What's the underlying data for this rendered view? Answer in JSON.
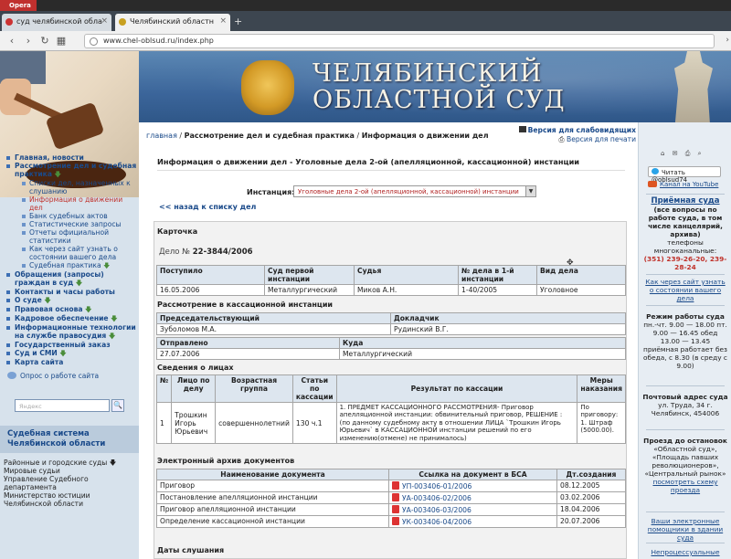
{
  "browser": {
    "opera_label": "Opera",
    "tabs": [
      {
        "title": "суд челябинской обла"
      },
      {
        "title": "Челябинский областн"
      }
    ],
    "url": "www.chel-oblsud.ru/index.php"
  },
  "banner": {
    "title_line1": "ЧЕЛЯБИНСКИЙ",
    "title_line2": "ОБЛАСТНОЙ СУД"
  },
  "breadcrumb": {
    "home": "главная",
    "sep": " / ",
    "level2": "Рассмотрение дел и судебная практика",
    "level3": "Информация о движении дел"
  },
  "versions": {
    "visually_impaired": "Версия для слабовидящих",
    "print": "Версия для печати"
  },
  "sidebar": {
    "menu": [
      {
        "label": "Главная, новости",
        "type": "item"
      },
      {
        "label": "Рассмотрение дел и судебная практика",
        "type": "item",
        "arrow": "🡇"
      },
      {
        "label": "Списки дел, назначенных к слушанию",
        "type": "sub"
      },
      {
        "label": "Информация о движении дел",
        "type": "sub",
        "current": true
      },
      {
        "label": "Банк судебных актов",
        "type": "sub"
      },
      {
        "label": "Статистические запросы",
        "type": "sub"
      },
      {
        "label": "Отчеты официальной статистики",
        "type": "sub"
      },
      {
        "label": "Как через сайт узнать о состоянии вашего дела",
        "type": "sub"
      },
      {
        "label": "Судебная практика",
        "type": "sub",
        "arrow": "🡇"
      },
      {
        "label": "Обращения (запросы) граждан в суд",
        "type": "item",
        "arrow": "🡇"
      },
      {
        "label": "Контакты и часы работы",
        "type": "item"
      },
      {
        "label": "О суде",
        "type": "item",
        "arrow": "🡇"
      },
      {
        "label": "Правовая основа",
        "type": "item",
        "arrow": "🡇"
      },
      {
        "label": "Кадровое обеспечение",
        "type": "item",
        "arrow": "🡇"
      },
      {
        "label": "Информационные технологии на службе правосудия",
        "type": "item",
        "arrow": "🡇"
      },
      {
        "label": "Государственный заказ",
        "type": "item"
      },
      {
        "label": "Суд и СМИ",
        "type": "item",
        "arrow": "🡇"
      },
      {
        "label": "Карта сайта",
        "type": "item"
      }
    ],
    "ask_link": "Опрос о работе сайта",
    "search_placeholder": "Яндекс",
    "search_button": "🔍",
    "system_title": "Судебная система Челябинской области",
    "system_menu": [
      {
        "label": "Районные и городские суды",
        "arrow": "🡇"
      },
      {
        "label": "Мировые судьи"
      },
      {
        "label": "Управление Судебного департамента"
      },
      {
        "label": "Министерство юстиции Челябинской области"
      }
    ]
  },
  "main": {
    "heading": "Информация о движении дел - Уголовные дела 2-ой (апелляционной, кассационной) инстанции",
    "instance_label": "Инстанция:",
    "instance_value": "Уголовные дела 2-ой (апелляционной, кассационной) инстанции",
    "back_link": "<< назад к списку дел",
    "card_title": "Карточка",
    "case_prefix": "Дело № ",
    "case_number": "22-3844/2006",
    "case_table": {
      "headers": [
        "Поступило",
        "Суд первой инстанции",
        "Судья",
        "№ дела в 1-й инстанции",
        "Вид дела"
      ],
      "row": [
        "16.05.2006",
        "Металлургический",
        "Миков А.Н.",
        "1-40/2005",
        "Уголовное"
      ]
    },
    "cassation_title": "Рассмотрение в кассационной инстанции",
    "cassation_table": {
      "h1": "Председательствующий",
      "h2": "Докладчик",
      "v1": "Зуболомов М.А.",
      "v2": "Рудинский В.Г.",
      "h3": "Отправлено",
      "h4": "Куда",
      "v3": "27.07.2006",
      "v4": "Металлургический"
    },
    "persons_title": "Сведения о лицах",
    "persons_table": {
      "headers": [
        "№",
        "Лицо по делу",
        "Возрастная группа",
        "Статьи по кассации",
        "Результат по кассации",
        "Меры наказания"
      ],
      "row": {
        "n": "1",
        "person": "Трошкин Игорь Юрьевич",
        "age": "совершеннолетний",
        "article": "130 ч.1",
        "result": "1. ПРЕДМЕТ КАССАЦИОННОГО РАССМОТРЕНИЯ- Приговор апелляционной инстанции: обвинительный приговор, РЕШЕНИЕ : (по данному судебному акту в отношении ЛИЦА `Трошкин Игорь Юрьевич` в КАССАЦИОННОЙ инстанции решений по его изменению(отмене) не принималось)",
        "measures": "По приговору: 1. Штраф (5000.00)."
      }
    },
    "archive_title": "Электронный архив документов",
    "archive_table": {
      "headers": [
        "Наименование документа",
        "Ссылка на документ в БСА",
        "Дт.создания"
      ],
      "rows": [
        {
          "name": "Приговор",
          "link": "УП-003406-01/2006",
          "date": "08.12.2005"
        },
        {
          "name": "Постановление апелляционной инстанции",
          "link": "УА-003406-02/2006",
          "date": "03.02.2006"
        },
        {
          "name": "Приговор апелляционной инстанции",
          "link": "УА-003406-03/2006",
          "date": "18.04.2006"
        },
        {
          "name": "Определение кассационной инстанции",
          "link": "УК-003406-04/2006",
          "date": "20.07.2006"
        }
      ]
    },
    "hearings_title": "Даты слушания"
  },
  "rightcol": {
    "icons": "⌂ ✉ ⎙ ⌕",
    "twitter": "Читать @oblsud74",
    "youtube": "Канал на YouTube",
    "reception_title": "Приёмная суда",
    "reception_bold": "(все вопросы по работе суда, в том числе канцелярий, архива)",
    "reception_phone_label": "телефоны многоканальные:",
    "reception_phone": "(351) 239-26-20, 239-28-24",
    "howto_link": "Как через сайт узнать о состоянии вашего дела",
    "hours_title": "Режим работы суда",
    "hours_text": "пн.-чт. 9.00 — 18.00 пт. 9.00 — 16.45 обед 13.00 — 13.45 приёмная работает без обеда, с 8.30 (в среду с 9.00)",
    "address_title": "Почтовый адрес суда",
    "address_text": "ул. Труда, 34 г. Челябинск, 454006",
    "transit_title": "Проезд до остановок",
    "transit_text": "«Областной суд», «Площадь павших революционеров», «Центральный рынок»",
    "transit_link": "посмотреть схему проезда",
    "helpers_link": "Ваши электронные помощники в здании суда",
    "procedural_link": "Непроцессуальные"
  }
}
